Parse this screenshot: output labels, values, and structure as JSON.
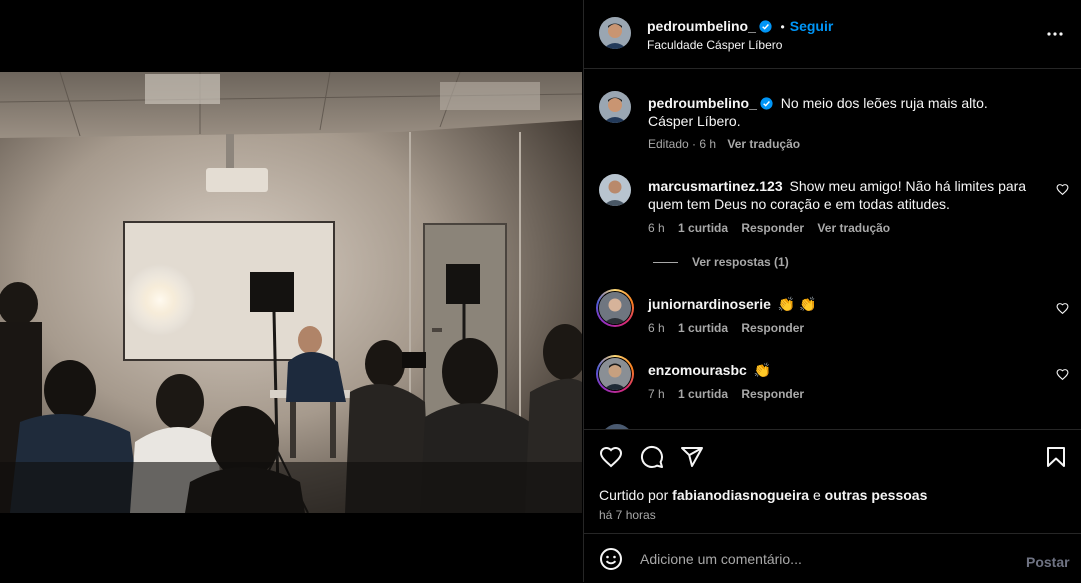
{
  "post": {
    "author": "pedroumbelino_",
    "follow_separator": "•",
    "follow_label": "Seguir",
    "location": "Faculdade Cásper Líbero"
  },
  "caption": {
    "author": "pedroumbelino_",
    "line1": "No meio dos leões ruja mais alto.",
    "line2": "Cásper Líbero.",
    "meta": "Editado · 6 h",
    "translate": "Ver tradução"
  },
  "comments": [
    {
      "user": "marcusmartinez.123",
      "text_line1": "Show meu amigo! Não há limites para",
      "text_line2": "quem tem Deus no coração e em todas atitudes.",
      "time": "6 h",
      "likes": "1 curtida",
      "reply": "Responder",
      "translate": "Ver tradução",
      "replies_label": "Ver respostas (1)"
    },
    {
      "user": "juniornardinoserie",
      "text": "👏 👏",
      "time": "6 h",
      "likes": "1 curtida",
      "reply": "Responder"
    },
    {
      "user": "enzomourasbc",
      "text": "👏",
      "time": "7 h",
      "likes": "1 curtida",
      "reply": "Responder"
    }
  ],
  "likes_line": {
    "prefix": "Curtido por",
    "user": "fabianodiasnogueira",
    "middle": "e",
    "suffix": "outras pessoas"
  },
  "timestamp": "há 7 horas",
  "composer": {
    "placeholder": "Adicione um comentário...",
    "post_label": "Postar"
  },
  "icons": {
    "header": [
      "verified-badge-icon",
      "more-options-icon"
    ],
    "actions": [
      "like-heart-icon",
      "comment-bubble-icon",
      "share-send-icon",
      "save-bookmark-icon"
    ],
    "composer": [
      "emoji-icon"
    ]
  },
  "colors": {
    "background": "#000000",
    "text": "#f5f5f5",
    "muted": "#a8a8a8",
    "link_blue": "#0095f6",
    "divider": "#262626"
  }
}
